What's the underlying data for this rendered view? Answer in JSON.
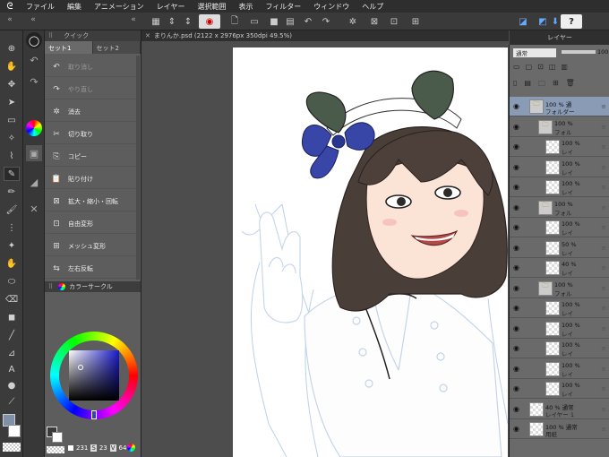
{
  "menubar": {
    "items": [
      "ファイル",
      "編集",
      "アニメーション",
      "レイヤー",
      "選択範囲",
      "表示",
      "フィルター",
      "ウィンドウ",
      "ヘルプ"
    ]
  },
  "document": {
    "tab_title": "まりんか.psd (2122 x 2976px 350dpi 49.5%)"
  },
  "quick_access": {
    "header": "クイック",
    "tabs": [
      "セット1",
      "セット2"
    ],
    "items": [
      {
        "label": "取り消し",
        "icon": "undo-icon",
        "dim": true
      },
      {
        "label": "やり直し",
        "icon": "redo-icon",
        "dim": true
      },
      {
        "label": "消去",
        "icon": "clear-icon",
        "dim": false
      },
      {
        "label": "切り取り",
        "icon": "cut-icon",
        "dim": false
      },
      {
        "label": "コピー",
        "icon": "copy-icon",
        "dim": false
      },
      {
        "label": "貼り付け",
        "icon": "paste-icon",
        "dim": false
      },
      {
        "label": "拡大・縮小・回転",
        "icon": "scale-icon",
        "dim": false
      },
      {
        "label": "自由変形",
        "icon": "free-transform-icon",
        "dim": false
      },
      {
        "label": "メッシュ変形",
        "icon": "mesh-icon",
        "dim": false
      },
      {
        "label": "左右反転",
        "icon": "flip-icon",
        "dim": false
      }
    ]
  },
  "color_panel": {
    "header": "カラーサークル",
    "readout": {
      "h": "231",
      "s": "23",
      "v": "64"
    },
    "s_label": "S",
    "v_label": "V"
  },
  "layer_panel": {
    "header": "レイヤー",
    "blend_mode": "通常",
    "opacity": "100",
    "layers": [
      {
        "pct": "100 % 通",
        "name": "フォルダー",
        "folder": true,
        "selected": true
      },
      {
        "pct": "100 %",
        "name": "フォル",
        "folder": true
      },
      {
        "pct": "100 %",
        "name": "レイ"
      },
      {
        "pct": "100 %",
        "name": "レイ"
      },
      {
        "pct": "100 %",
        "name": "レイ"
      },
      {
        "pct": "100 %",
        "name": "フォル",
        "folder": true
      },
      {
        "pct": "100 %",
        "name": "レイ"
      },
      {
        "pct": "50 %",
        "name": "レイ"
      },
      {
        "pct": "40 %",
        "name": "レイ"
      },
      {
        "pct": "100 %",
        "name": "フォル",
        "folder": true
      },
      {
        "pct": "100 %",
        "name": "レイ"
      },
      {
        "pct": "100 %",
        "name": "レイ"
      },
      {
        "pct": "100 %",
        "name": "レイ"
      },
      {
        "pct": "100 %",
        "name": "レイ"
      },
      {
        "pct": "100 %",
        "name": "レイ"
      },
      {
        "pct": "40 % 通常",
        "name": "レイヤー 1"
      },
      {
        "pct": "100 % 通常",
        "name": "用紙"
      }
    ]
  }
}
